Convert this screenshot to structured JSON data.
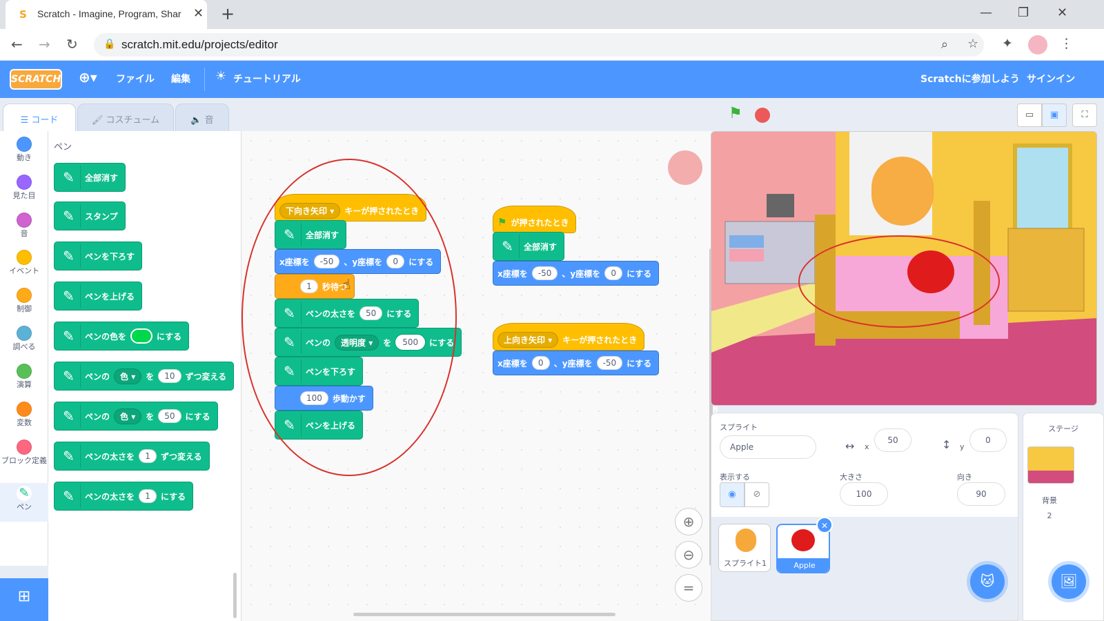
{
  "browser": {
    "tab_title": "Scratch - Imagine, Program, Shar",
    "url": "scratch.mit.edu/projects/editor",
    "close_glyph": "✕",
    "new_tab_glyph": "+"
  },
  "menu": {
    "logo": "SCRATCH",
    "file": "ファイル",
    "edit": "編集",
    "tutorials": "チュートリアル",
    "join": "Scratchに参加しよう",
    "signin": "サインイン"
  },
  "tabs": {
    "code": "コード",
    "costumes": "コスチューム",
    "sounds": "音"
  },
  "categories": [
    {
      "label": "動き",
      "color": "#4c97ff"
    },
    {
      "label": "見た目",
      "color": "#9966ff"
    },
    {
      "label": "音",
      "color": "#cf63cf"
    },
    {
      "label": "イベント",
      "color": "#ffbf00"
    },
    {
      "label": "制御",
      "color": "#ffab19"
    },
    {
      "label": "調べる",
      "color": "#5cb1d6"
    },
    {
      "label": "演算",
      "color": "#59c059"
    },
    {
      "label": "変数",
      "color": "#ff8c1a"
    },
    {
      "label": "ブロック定義",
      "color": "#ff6680"
    },
    {
      "label": "ペン",
      "color": ""
    }
  ],
  "palette": {
    "title": "ペン",
    "clear": "全部消す",
    "stamp": "スタンプ",
    "pen_down": "ペンを下ろす",
    "pen_up": "ペンを上げる",
    "set_color_a": "ペンの色を",
    "set_color_b": "にする",
    "change_param_a": "ペンの",
    "change_param_dd": "色",
    "change_param_b": "を",
    "change_param_val": "10",
    "change_param_c": "ずつ変える",
    "set_param_a": "ペンの",
    "set_param_dd": "色",
    "set_param_b": "を",
    "set_param_val": "50",
    "set_param_c": "にする",
    "change_size_a": "ペンの太さを",
    "change_size_val": "1",
    "change_size_b": "ずつ変える",
    "set_size_a": "ペンの太さを",
    "set_size_val": "1",
    "set_size_b": "にする"
  },
  "script1": {
    "hat_dd": "下向き矢印",
    "hat_text": "キーが押されたとき",
    "clear": "全部消す",
    "goto_a": "x座標を",
    "goto_x": "-50",
    "goto_b": "、y座標を",
    "goto_y": "0",
    "goto_c": "にする",
    "wait_val": "1",
    "wait_text": "秒待つ",
    "size_a": "ペンの太さを",
    "size_val": "50",
    "size_b": "にする",
    "trans_a": "ペンの",
    "trans_dd": "透明度",
    "trans_b": "を",
    "trans_val": "500",
    "trans_c": "にする",
    "pen_down": "ペンを下ろす",
    "move_val": "100",
    "move_text": "歩動かす",
    "pen_up": "ペンを上げる"
  },
  "script2": {
    "hat_text": "が押されたとき",
    "clear": "全部消す",
    "goto_a": "x座標を",
    "goto_x": "-50",
    "goto_b": "、y座標を",
    "goto_y": "0",
    "goto_c": "にする"
  },
  "script3": {
    "hat_dd": "上向き矢印",
    "hat_text": "キーが押されたとき",
    "goto_a": "x座標を",
    "goto_x": "0",
    "goto_b": "、y座標を",
    "goto_y": "-50",
    "goto_c": "にする"
  },
  "sprite_info": {
    "sprite_label": "スプライト",
    "name": "Apple",
    "x_label": "x",
    "x": "50",
    "y_label": "y",
    "y": "0",
    "show_label": "表示する",
    "size_label": "大きさ",
    "size": "100",
    "direction_label": "向き",
    "direction": "90"
  },
  "sprites": [
    {
      "name": "スプライト1"
    },
    {
      "name": "Apple"
    }
  ],
  "stage_panel": {
    "title": "ステージ",
    "backdrop_label": "背景",
    "backdrop_count": "2"
  },
  "colors": {
    "accent": "#4c97ff",
    "pen": "#0fbd8c",
    "annotation": "#d9312b"
  }
}
